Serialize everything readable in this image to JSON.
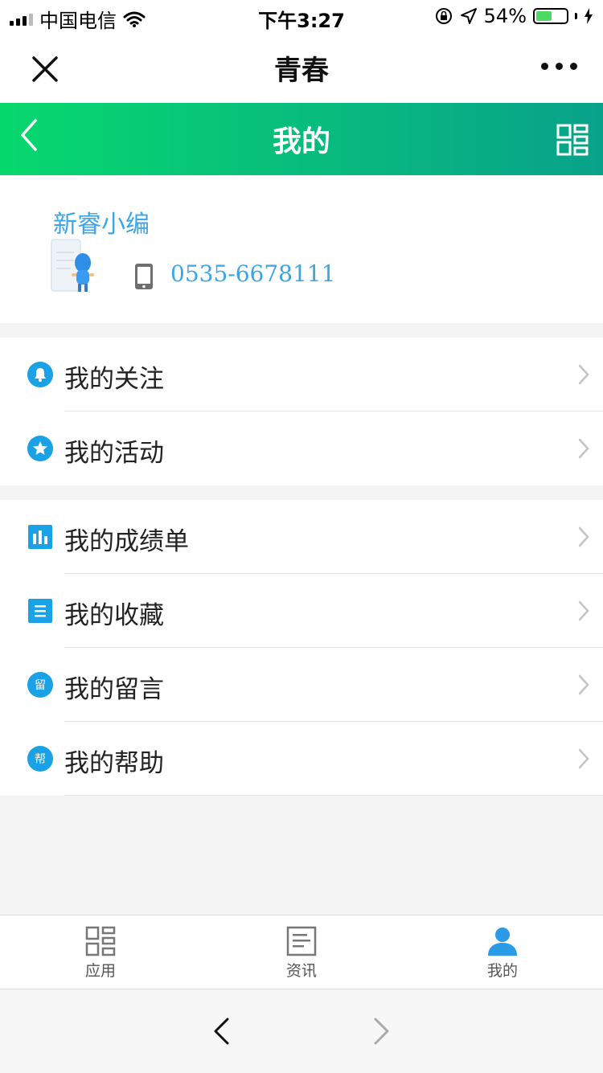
{
  "status_bar": {
    "carrier": "中国电信",
    "time": "下午3:27",
    "battery_percent_text": "54%",
    "battery_level": 0.54
  },
  "wechat_nav": {
    "title": "青春",
    "close_icon": "close-icon",
    "more_icon": "more-dots-icon"
  },
  "app_header": {
    "title": "我的",
    "back_icon": "chevron-left-icon",
    "grid_icon": "grid-icon",
    "gradient_from": "#07d86e",
    "gradient_to": "#08a28a"
  },
  "profile": {
    "name": "新睿小编",
    "phone": "0535-6678111",
    "avatar_icon": "avatar-illustration-icon",
    "phone_icon": "phone-icon"
  },
  "menu_groups": [
    {
      "items": [
        {
          "label": "我的关注",
          "icon": "bell-icon"
        },
        {
          "label": "我的活动",
          "icon": "star-icon"
        }
      ]
    },
    {
      "items": [
        {
          "label": "我的成绩单",
          "icon": "bar-chart-icon"
        },
        {
          "label": "我的收藏",
          "icon": "list-icon"
        },
        {
          "label": "我的留言",
          "icon": "message-badge-icon",
          "badge_text": "留"
        },
        {
          "label": "我的帮助",
          "icon": "help-badge-icon",
          "badge_text": "帮"
        }
      ]
    }
  ],
  "tabbar": {
    "tabs": [
      {
        "label": "应用",
        "icon": "grid-icon",
        "active": false
      },
      {
        "label": "资讯",
        "icon": "news-icon",
        "active": false
      },
      {
        "label": "我的",
        "icon": "user-icon",
        "active": true
      }
    ]
  },
  "browser_bar": {
    "back_icon": "chevron-left-icon",
    "forward_icon": "chevron-right-icon"
  },
  "colors": {
    "accent_blue": "#1aa1e6",
    "link_blue": "#3aa5e8",
    "tab_active": "#2a9be6"
  }
}
